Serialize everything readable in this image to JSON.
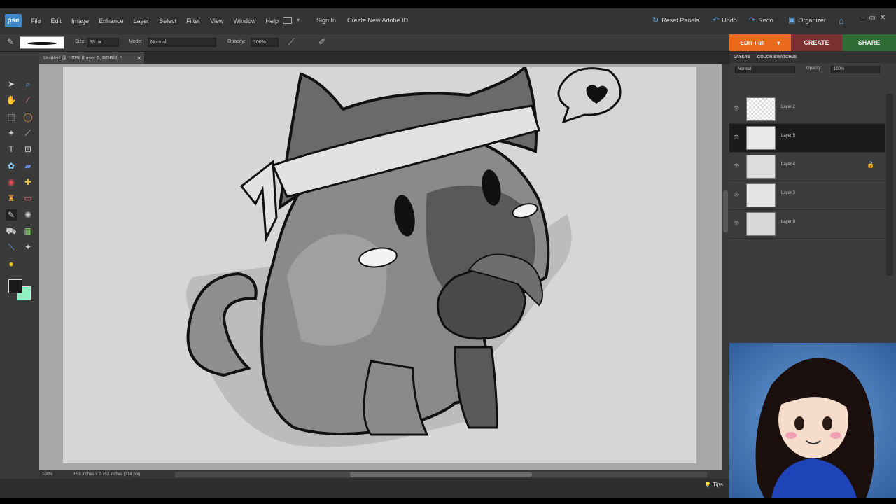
{
  "app": {
    "logo": "pse"
  },
  "menu": [
    "File",
    "Edit",
    "Image",
    "Enhance",
    "Layer",
    "Select",
    "Filter",
    "View",
    "Window",
    "Help"
  ],
  "account": {
    "sign_in": "Sign In",
    "create_id": "Create New Adobe ID"
  },
  "toolbar_right": {
    "reset_panels": "Reset Panels",
    "undo": "Undo",
    "redo": "Redo",
    "organizer": "Organizer"
  },
  "options": {
    "size_label": "Size:",
    "size_value": "19 px",
    "mode_label": "Mode:",
    "mode_value": "Normal",
    "opacity_label": "Opacity:",
    "opacity_value": "100%"
  },
  "edit_tabs": {
    "full": "EDIT Full",
    "create": "CREATE",
    "share": "SHARE"
  },
  "document": {
    "tab_title": "Untitled @ 100% (Layer 5, RGB/8) *",
    "zoom": "100%",
    "info": "3.58 inches x 2.753 inches (314 ppi)"
  },
  "panel": {
    "tabs": [
      "LAYERS",
      "COLOR SWATCHES"
    ],
    "blend_mode": "Normal",
    "opacity_label": "Opacity:",
    "opacity_value": "100%",
    "layers": [
      {
        "name": "Layer 2",
        "selected": false,
        "locked": false
      },
      {
        "name": "Layer 5",
        "selected": true,
        "locked": false
      },
      {
        "name": "Layer 4",
        "selected": false,
        "locked": true
      },
      {
        "name": "Layer 3",
        "selected": false,
        "locked": false
      },
      {
        "name": "Layer 0",
        "selected": false,
        "locked": false
      }
    ]
  },
  "status": {
    "tips": "Tips"
  },
  "colors": {
    "foreground": "#1a1a1a",
    "background": "#8ff0c2",
    "edit_full_tab": "#e86a1a",
    "create_tab": "#7a3030",
    "share_tab": "#2f6b35"
  }
}
